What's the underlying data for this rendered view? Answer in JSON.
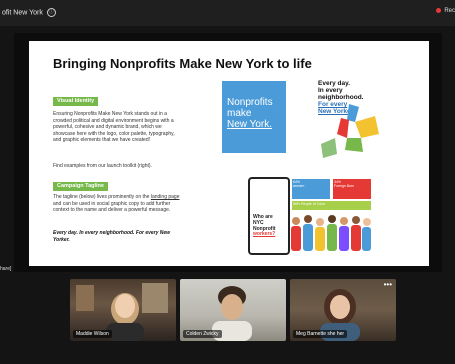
{
  "window": {
    "title": "ofit New York",
    "info_icon": "ⓘ",
    "rec_label": "Rec"
  },
  "share_tag": "hare]",
  "slide": {
    "title": "Bringing Nonprofits Make New York to life",
    "visual_identity": {
      "label": "Visual Identity",
      "body": "Ensuring Nonprofits Make New York stands out in a crowded political and digital environment begins with a powerful, cohesive and dynamic brand, which we showcase here with the logo, color palette, typography, and graphic elements that we have created!",
      "note": "Find examples from our launch toolkit (right)."
    },
    "campaign_tagline": {
      "label": "Campaign Tagline",
      "body_1": "The tagline (below) lives prominently on the",
      "link": "landing page",
      "body_2": "and can be used in social graphic copy to add further context to the name and deliver a powerful message.",
      "tagline": "Every day. In every neighborhood. For every New Yorker."
    },
    "logo": {
      "line1": "Nonprofits",
      "line2": "make",
      "line3": "New York."
    },
    "everyday": {
      "line1": "Every day.",
      "line2": "In every",
      "line3": "neighborhood.",
      "line4": "For every",
      "line5": "New Yorker."
    },
    "poster": {
      "who_1": "Who are",
      "who_2": "NYC Nonprofit",
      "who_3": "workers?",
      "tile_1_pct": "64%",
      "tile_1_label": "women",
      "tile_2_pct": "34%",
      "tile_2_label": "Foreign Born",
      "tile_3": "56% People of Color"
    }
  },
  "participants": [
    {
      "name": "Maddie Wilson"
    },
    {
      "name": "Colden Zwicky"
    },
    {
      "name": "Meg Barnette she her"
    }
  ],
  "colors": {
    "green": "#76b84a",
    "blue": "#4b9bd8",
    "rec": "#e53935"
  }
}
